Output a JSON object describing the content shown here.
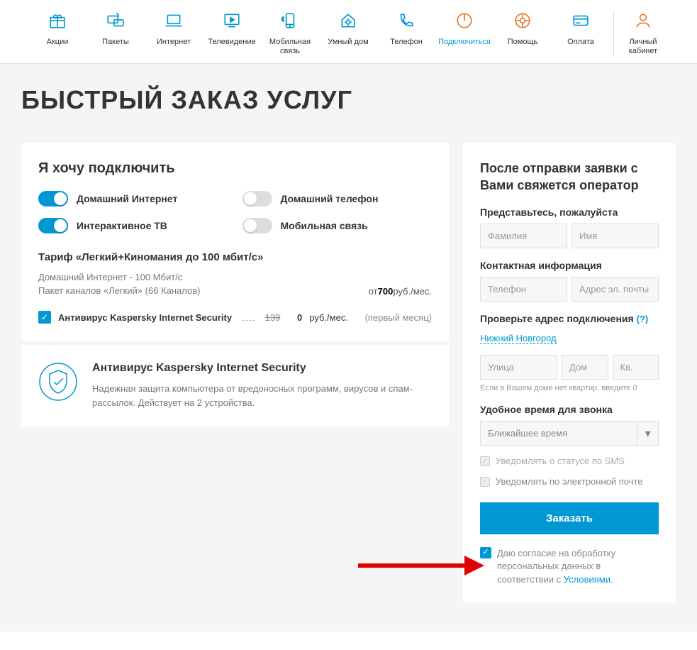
{
  "nav": [
    {
      "label": "Акции",
      "icon": "gift"
    },
    {
      "label": "Пакеты",
      "icon": "packages"
    },
    {
      "label": "Интернет",
      "icon": "laptop"
    },
    {
      "label": "Телевидение",
      "icon": "tv"
    },
    {
      "label": "Мобильная связь",
      "icon": "mobile"
    },
    {
      "label": "Умный дом",
      "icon": "home"
    },
    {
      "label": "Телефон",
      "icon": "phone"
    },
    {
      "label": "Подключиться",
      "icon": "power",
      "cls": "connect"
    },
    {
      "label": "Помощь",
      "icon": "help",
      "cls": "help"
    },
    {
      "label": "Оплата",
      "icon": "card"
    }
  ],
  "nav_account": {
    "label": "Личный кабинет"
  },
  "page_title": "БЫСТРЫЙ ЗАКАЗ УСЛУГ",
  "connect_title": "Я хочу подключить",
  "toggles": [
    {
      "label": "Домашний Интернет",
      "on": true
    },
    {
      "label": "Домашний телефон",
      "on": false
    },
    {
      "label": "Интерактивное ТВ",
      "on": true
    },
    {
      "label": "Мобильная связь",
      "on": false
    }
  ],
  "tariff": {
    "name": "Тариф «Легкий+Киномания до 100 мбит/с»",
    "line1": "Домашний Интернет - 100 Мбит/с",
    "line2": "Пакет каналов «Легкий» (66 Каналов)",
    "price_prefix": "от ",
    "price": "700",
    "price_unit": " руб./мес."
  },
  "addon": {
    "name": "Антивирус Kaspersky Internet Security",
    "old_price": "139",
    "price": "0",
    "unit": " руб./мес.",
    "note": "(первый месяц)"
  },
  "av_banner": {
    "title": "Антивирус Kaspersky Internet Security",
    "desc": "Надежная защита компьютера от вредоносных программ, вирусов и спам-рассылок. Действует на 2 устройства."
  },
  "form": {
    "title": "После отправки заявки с Вами свяжется оператор",
    "intro_label": "Представьтесь, пожалуйста",
    "lastname_ph": "Фамилия",
    "firstname_ph": "Имя",
    "contact_label": "Контактная информация",
    "phone_ph": "Телефон",
    "email_ph": "Адрес эл. почты",
    "address_label": "Проверьте адрес подключения",
    "address_help": "(?)",
    "city": "Нижний Новгород",
    "street_ph": "Улица",
    "house_ph": "Дом",
    "apt_ph": "Кв.",
    "apt_hint": "Если в Вашем доме нет квартир, введите 0",
    "time_label": "Удобное время для звонка",
    "time_value": "Ближайшее время",
    "notify_sms": "Уведомлять о статусе по SMS",
    "notify_email": "Уведомлять по электронной почте",
    "order_btn": "Заказать",
    "consent_pre": "Даю согласие на обработку персональных данных в соответствии с ",
    "consent_link": "Условиями",
    "consent_post": "."
  }
}
